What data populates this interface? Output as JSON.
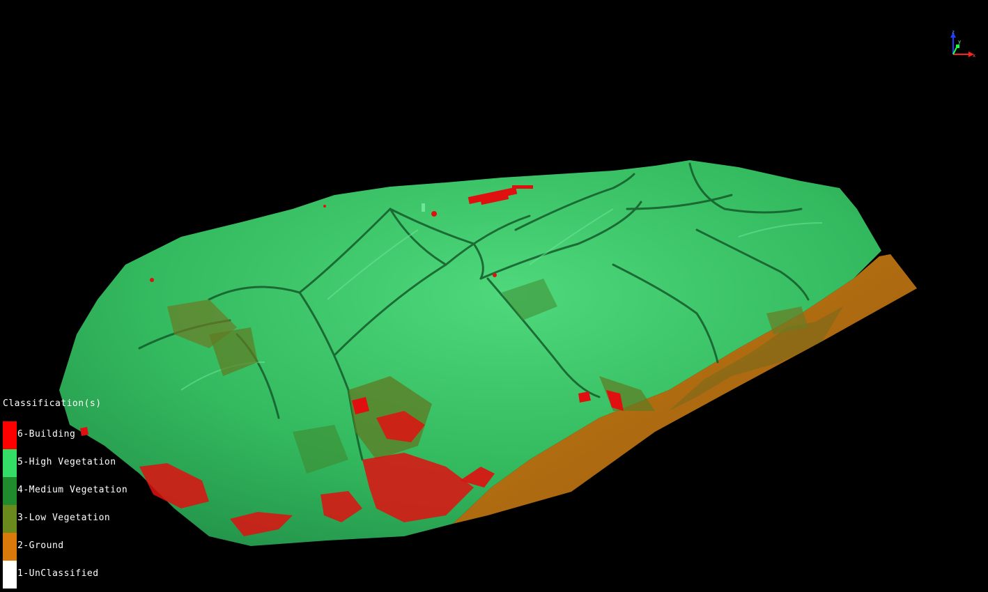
{
  "legend": {
    "title": "Classification(s)",
    "items": [
      {
        "label": "6-Building",
        "color": "#ff0000"
      },
      {
        "label": "5-High Vegetation",
        "color": "#33dd66"
      },
      {
        "label": "4-Medium Vegetation",
        "color": "#1f8a2e"
      },
      {
        "label": "3-Low Vegetation",
        "color": "#6b8a1e"
      },
      {
        "label": "2-Ground",
        "color": "#d97a0a"
      },
      {
        "label": "1-UnClassified",
        "color": "#ffffff"
      }
    ]
  },
  "axes": {
    "x_label": "x",
    "y_label": "y",
    "z_label": "z",
    "x_color": "#ff2020",
    "y_color": "#20ff40",
    "z_color": "#2040ff"
  },
  "colors": {
    "background": "#000000",
    "terrain": "#2fae55",
    "terrain_light": "#48d472",
    "terrain_dark": "#1e7a3a",
    "ground": "#b86d12",
    "building": "#e01010"
  }
}
